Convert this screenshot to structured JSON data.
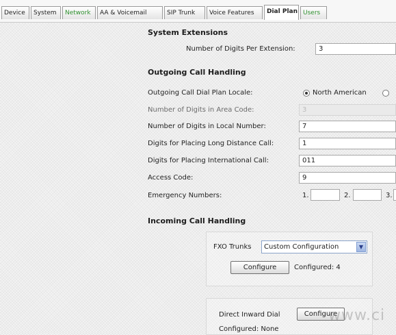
{
  "tabs": [
    {
      "label": "Device"
    },
    {
      "label": "System"
    },
    {
      "label": "Network"
    },
    {
      "label": "AA & Voicemail"
    },
    {
      "label": "SIP Trunk"
    },
    {
      "label": "Voice Features"
    },
    {
      "label": "Dial Plan"
    },
    {
      "label": "Users"
    }
  ],
  "active_tab": "Dial Plan",
  "system_extensions": {
    "heading": "System Extensions",
    "digits_label": "Number of Digits Per Extension:",
    "digits_value": "3"
  },
  "outgoing": {
    "heading": "Outgoing Call Handling",
    "locale_label": "Outgoing Call Dial Plan Locale:",
    "locale_option_1": "North American",
    "locale_selected": "North American",
    "area_code_label": "Number of Digits in Area Code:",
    "area_code_value": "3",
    "local_number_label": "Number of Digits in Local Number:",
    "local_number_value": "7",
    "long_distance_label": "Digits for Placing Long Distance Call:",
    "long_distance_value": "1",
    "international_label": "Digits for Placing International Call:",
    "international_value": "011",
    "access_code_label": "Access Code:",
    "access_code_value": "9",
    "emergency_label": "Emergency Numbers:",
    "emergency_1_prefix": "1.",
    "emergency_2_prefix": "2.",
    "emergency_3_prefix": "3."
  },
  "incoming": {
    "heading": "Incoming Call Handling",
    "fxo_label": "FXO Trunks",
    "fxo_selected": "Custom Configuration",
    "configure_label": "Configure",
    "fxo_configured": "Configured: 4",
    "did_label": "Direct Inward Dial",
    "did_configure_label": "Configure",
    "did_configured": "Configured: None"
  },
  "watermark": "www.ci",
  "colors": {
    "green_tab": "#2e8f2e",
    "select_border": "#8aa3c9"
  },
  "icons": {
    "dropdown": "chevron-down-icon",
    "radio": "radio-icon"
  }
}
